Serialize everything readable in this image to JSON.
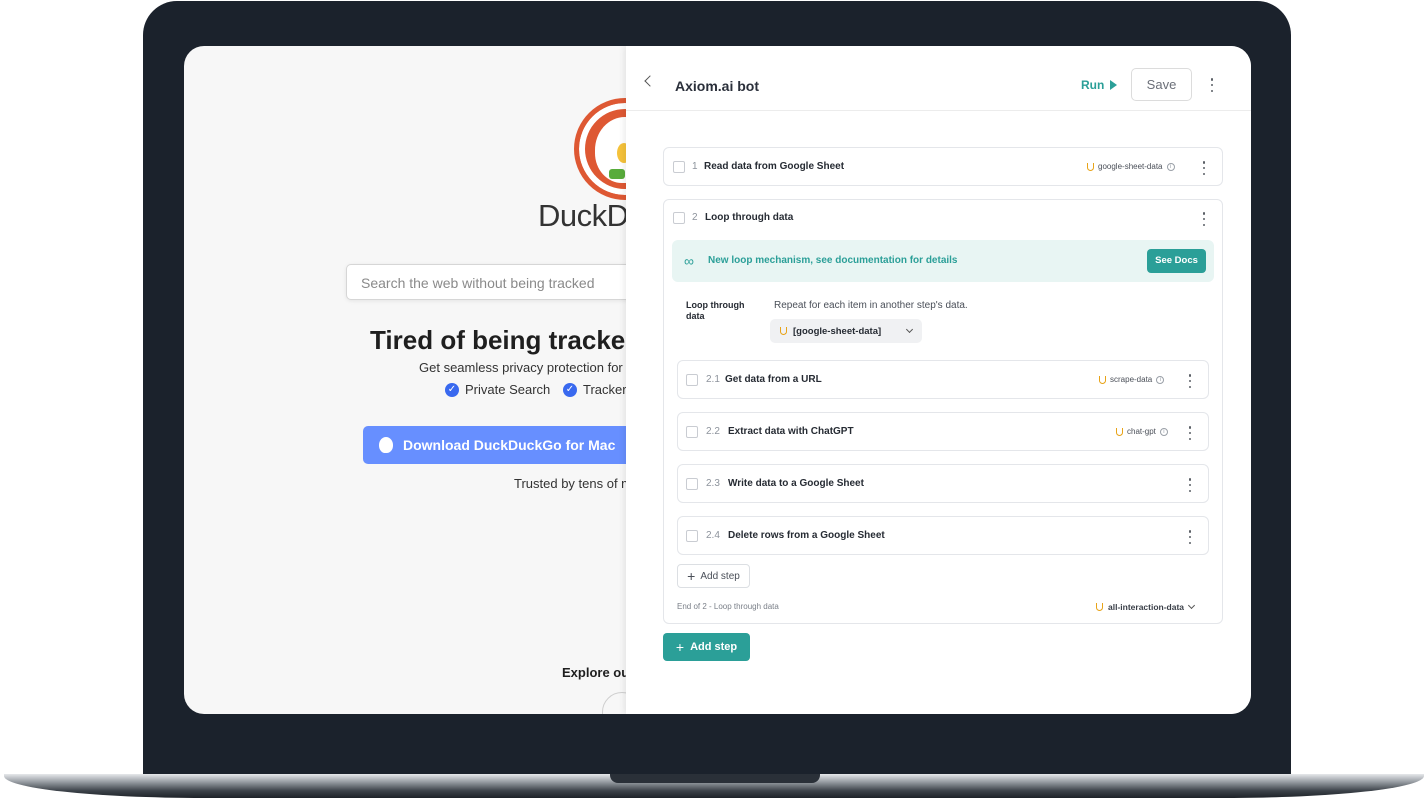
{
  "browser": {
    "logo_word": "DuckD",
    "search_placeholder": "Search the web without being tracked",
    "headline": "Tired of being tracked",
    "subline": "Get seamless privacy protection for",
    "feature_1": "Private Search",
    "feature_2": "Tracker",
    "download_label": "Download DuckDuckGo for Mac",
    "trusted_text": "Trusted by tens of m",
    "explore_text": "Explore ou"
  },
  "panel": {
    "title": "Axiom.ai bot",
    "run_label": "Run",
    "save_label": "Save",
    "steps": [
      {
        "number": "1",
        "label": "Read data from Google Sheet",
        "tag": "google-sheet-data"
      },
      {
        "number": "2",
        "label": "Loop through data"
      }
    ],
    "banner": {
      "text": "New loop mechanism, see documentation for details",
      "button": "See Docs"
    },
    "loop": {
      "label": "Loop through data",
      "description": "Repeat for each item in another step's data.",
      "selected": "[google-sheet-data]"
    },
    "substeps": [
      {
        "number": "2.1",
        "label": "Get data from a URL",
        "tag": "scrape-data"
      },
      {
        "number": "2.2",
        "label": "Extract data with ChatGPT",
        "tag": "chat-gpt"
      },
      {
        "number": "2.3",
        "label": "Write data to a Google Sheet"
      },
      {
        "number": "2.4",
        "label": "Delete rows from a Google Sheet"
      }
    ],
    "inner_add_step": "Add step",
    "end_label": "End of 2 - Loop through data",
    "end_tag": "all-interaction-data",
    "add_step": "Add step"
  },
  "colors": {
    "accent": "#2b9f98",
    "frame": "#1b222c",
    "ddg_orange": "#de5833",
    "ddg_blue": "#678fff"
  }
}
